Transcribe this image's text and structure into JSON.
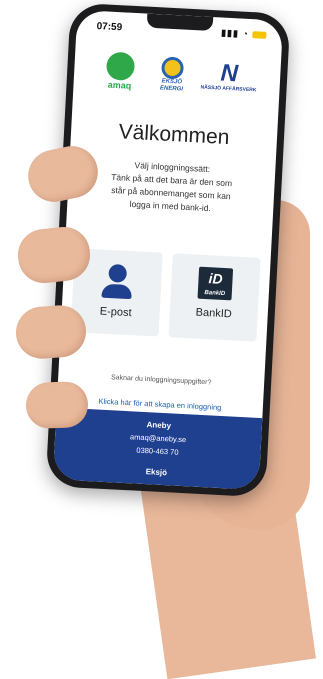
{
  "status_bar": {
    "time": "07:59",
    "signal_icon": "signal-icon",
    "wifi_icon": "wifi-icon",
    "battery_color": "#f5c400"
  },
  "logos": {
    "amaq": {
      "text": "amaq",
      "color": "#2fa84a"
    },
    "eksjo": {
      "text_line1": "EKSJÖ",
      "text_line2": "ENERGI",
      "color": "#2a61b0"
    },
    "nassjo": {
      "mark": "N",
      "text": "NÄSSJÖ AFFÄRSVERK",
      "color": "#1f3f8f"
    }
  },
  "welcome": {
    "title": "Välkommen",
    "instructions": [
      "Välj inloggningssätt:",
      "Tänk på att det bara är den som",
      "står på abonnemanget som kan",
      "logga in med bank-id."
    ]
  },
  "login_options": [
    {
      "label": "E-post",
      "icon": "person-icon"
    },
    {
      "label": "BankID",
      "icon": "bankid-icon",
      "icon_text": "iD",
      "icon_subtext": "BankID"
    }
  ],
  "missing_credentials": "Saknar du inloggningsuppgifter?",
  "create_login_link": "Klicka här för att skapa en inloggning",
  "footer": {
    "background": "#1f3f8f",
    "town": "Aneby",
    "email": "amaq@aneby.se",
    "phone": "0380-463 70",
    "next_town": "Eksjö"
  }
}
